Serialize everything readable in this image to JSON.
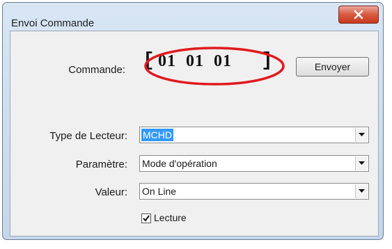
{
  "window": {
    "title": "Envoi Commande"
  },
  "command": {
    "label": "Commande:",
    "open_bracket": "[",
    "value": "01  01  01",
    "close_bracket": "]",
    "send_button": "Envoyer",
    "highlight_color": "#e0191e"
  },
  "fields": {
    "reader_type": {
      "label": "Type de Lecteur:",
      "value": "MCHD"
    },
    "parameter": {
      "label": "Paramètre:",
      "value": "Mode d'opération"
    },
    "value": {
      "label": "Valeur:",
      "value": "On Line"
    }
  },
  "read_checkbox": {
    "label": "Lecture",
    "checked": true
  },
  "icons": {
    "close": "close-icon",
    "dropdown": "chevron-down-icon",
    "check": "checkmark-icon"
  },
  "colors": {
    "selection": "#3399ff",
    "close_button": "#d9593f"
  }
}
